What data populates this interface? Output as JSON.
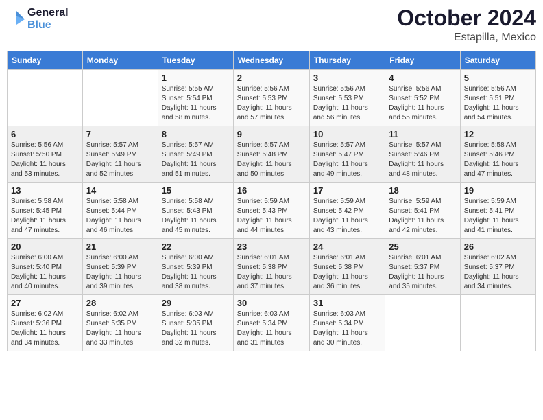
{
  "header": {
    "logo_line1": "General",
    "logo_line2": "Blue",
    "month": "October 2024",
    "location": "Estapilla, Mexico"
  },
  "weekdays": [
    "Sunday",
    "Monday",
    "Tuesday",
    "Wednesday",
    "Thursday",
    "Friday",
    "Saturday"
  ],
  "weeks": [
    [
      {
        "num": "",
        "info": ""
      },
      {
        "num": "",
        "info": ""
      },
      {
        "num": "1",
        "info": "Sunrise: 5:55 AM\nSunset: 5:54 PM\nDaylight: 11 hours\nand 58 minutes."
      },
      {
        "num": "2",
        "info": "Sunrise: 5:56 AM\nSunset: 5:53 PM\nDaylight: 11 hours\nand 57 minutes."
      },
      {
        "num": "3",
        "info": "Sunrise: 5:56 AM\nSunset: 5:53 PM\nDaylight: 11 hours\nand 56 minutes."
      },
      {
        "num": "4",
        "info": "Sunrise: 5:56 AM\nSunset: 5:52 PM\nDaylight: 11 hours\nand 55 minutes."
      },
      {
        "num": "5",
        "info": "Sunrise: 5:56 AM\nSunset: 5:51 PM\nDaylight: 11 hours\nand 54 minutes."
      }
    ],
    [
      {
        "num": "6",
        "info": "Sunrise: 5:56 AM\nSunset: 5:50 PM\nDaylight: 11 hours\nand 53 minutes."
      },
      {
        "num": "7",
        "info": "Sunrise: 5:57 AM\nSunset: 5:49 PM\nDaylight: 11 hours\nand 52 minutes."
      },
      {
        "num": "8",
        "info": "Sunrise: 5:57 AM\nSunset: 5:49 PM\nDaylight: 11 hours\nand 51 minutes."
      },
      {
        "num": "9",
        "info": "Sunrise: 5:57 AM\nSunset: 5:48 PM\nDaylight: 11 hours\nand 50 minutes."
      },
      {
        "num": "10",
        "info": "Sunrise: 5:57 AM\nSunset: 5:47 PM\nDaylight: 11 hours\nand 49 minutes."
      },
      {
        "num": "11",
        "info": "Sunrise: 5:57 AM\nSunset: 5:46 PM\nDaylight: 11 hours\nand 48 minutes."
      },
      {
        "num": "12",
        "info": "Sunrise: 5:58 AM\nSunset: 5:46 PM\nDaylight: 11 hours\nand 47 minutes."
      }
    ],
    [
      {
        "num": "13",
        "info": "Sunrise: 5:58 AM\nSunset: 5:45 PM\nDaylight: 11 hours\nand 47 minutes."
      },
      {
        "num": "14",
        "info": "Sunrise: 5:58 AM\nSunset: 5:44 PM\nDaylight: 11 hours\nand 46 minutes."
      },
      {
        "num": "15",
        "info": "Sunrise: 5:58 AM\nSunset: 5:43 PM\nDaylight: 11 hours\nand 45 minutes."
      },
      {
        "num": "16",
        "info": "Sunrise: 5:59 AM\nSunset: 5:43 PM\nDaylight: 11 hours\nand 44 minutes."
      },
      {
        "num": "17",
        "info": "Sunrise: 5:59 AM\nSunset: 5:42 PM\nDaylight: 11 hours\nand 43 minutes."
      },
      {
        "num": "18",
        "info": "Sunrise: 5:59 AM\nSunset: 5:41 PM\nDaylight: 11 hours\nand 42 minutes."
      },
      {
        "num": "19",
        "info": "Sunrise: 5:59 AM\nSunset: 5:41 PM\nDaylight: 11 hours\nand 41 minutes."
      }
    ],
    [
      {
        "num": "20",
        "info": "Sunrise: 6:00 AM\nSunset: 5:40 PM\nDaylight: 11 hours\nand 40 minutes."
      },
      {
        "num": "21",
        "info": "Sunrise: 6:00 AM\nSunset: 5:39 PM\nDaylight: 11 hours\nand 39 minutes."
      },
      {
        "num": "22",
        "info": "Sunrise: 6:00 AM\nSunset: 5:39 PM\nDaylight: 11 hours\nand 38 minutes."
      },
      {
        "num": "23",
        "info": "Sunrise: 6:01 AM\nSunset: 5:38 PM\nDaylight: 11 hours\nand 37 minutes."
      },
      {
        "num": "24",
        "info": "Sunrise: 6:01 AM\nSunset: 5:38 PM\nDaylight: 11 hours\nand 36 minutes."
      },
      {
        "num": "25",
        "info": "Sunrise: 6:01 AM\nSunset: 5:37 PM\nDaylight: 11 hours\nand 35 minutes."
      },
      {
        "num": "26",
        "info": "Sunrise: 6:02 AM\nSunset: 5:37 PM\nDaylight: 11 hours\nand 34 minutes."
      }
    ],
    [
      {
        "num": "27",
        "info": "Sunrise: 6:02 AM\nSunset: 5:36 PM\nDaylight: 11 hours\nand 34 minutes."
      },
      {
        "num": "28",
        "info": "Sunrise: 6:02 AM\nSunset: 5:35 PM\nDaylight: 11 hours\nand 33 minutes."
      },
      {
        "num": "29",
        "info": "Sunrise: 6:03 AM\nSunset: 5:35 PM\nDaylight: 11 hours\nand 32 minutes."
      },
      {
        "num": "30",
        "info": "Sunrise: 6:03 AM\nSunset: 5:34 PM\nDaylight: 11 hours\nand 31 minutes."
      },
      {
        "num": "31",
        "info": "Sunrise: 6:03 AM\nSunset: 5:34 PM\nDaylight: 11 hours\nand 30 minutes."
      },
      {
        "num": "",
        "info": ""
      },
      {
        "num": "",
        "info": ""
      }
    ]
  ]
}
